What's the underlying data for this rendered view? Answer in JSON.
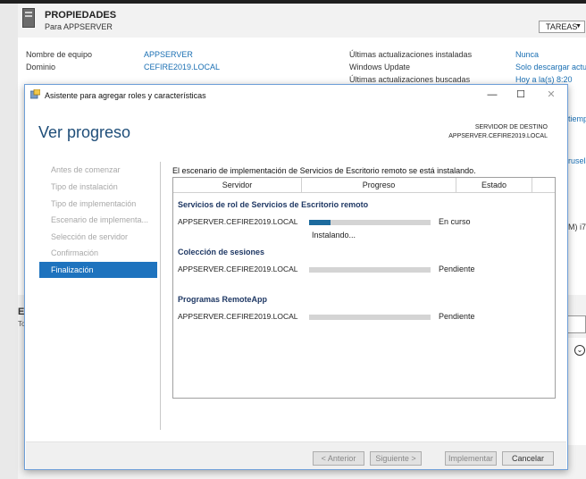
{
  "background": {
    "title": "PROPIEDADES",
    "subtitle": "Para APPSERVER",
    "tasks_label": "TAREAS",
    "properties": [
      {
        "label": "Nombre de equipo",
        "value": "APPSERVER"
      },
      {
        "label": "Dominio",
        "value": "CEFIRE2019.LOCAL"
      }
    ],
    "updates": [
      {
        "label": "Últimas actualizaciones instaladas",
        "value": "Nunca"
      },
      {
        "label": "Windows Update",
        "value": "Solo descargar actu"
      },
      {
        "label": "Últimas actualizaciones buscadas",
        "value": "Hoy a la(s) 8:20"
      }
    ],
    "right_fragments": [
      "tiemp",
      "ruselas",
      "M) i7"
    ],
    "lower_heading": "E",
    "lower_sub": "To"
  },
  "dialog": {
    "title": "Asistente para agregar roles y características",
    "heading": "Ver progreso",
    "destination_label": "SERVIDOR DE DESTINO",
    "destination_server": "APPSERVER.CEFIRE2019.LOCAL",
    "nav": [
      {
        "label": "Antes de comenzar"
      },
      {
        "label": "Tipo de instalación"
      },
      {
        "label": "Tipo de implementación"
      },
      {
        "label": "Escenario de implementa..."
      },
      {
        "label": "Selección de servidor"
      },
      {
        "label": "Confirmación"
      },
      {
        "label": "Finalización"
      }
    ],
    "active_nav": "Finalización",
    "status_message": "El escenario de implementación de Servicios de Escritorio remoto se está instalando.",
    "columns": [
      "Servidor",
      "Progreso",
      "Estado"
    ],
    "groups": [
      {
        "title": "Servicios de rol de Servicios de Escritorio remoto",
        "server": "APPSERVER.CEFIRE2019.LOCAL",
        "progress": 0.18,
        "status": "En curso",
        "detail": "Instalando..."
      },
      {
        "title": "Colección de sesiones",
        "server": "APPSERVER.CEFIRE2019.LOCAL",
        "progress": 0,
        "status": "Pendiente",
        "detail": ""
      },
      {
        "title": "Programas RemoteApp",
        "server": "APPSERVER.CEFIRE2019.LOCAL",
        "progress": 0,
        "status": "Pendiente",
        "detail": ""
      }
    ],
    "buttons": {
      "previous": "< Anterior",
      "next": "Siguiente >",
      "deploy": "Implementar",
      "cancel": "Cancelar"
    }
  }
}
